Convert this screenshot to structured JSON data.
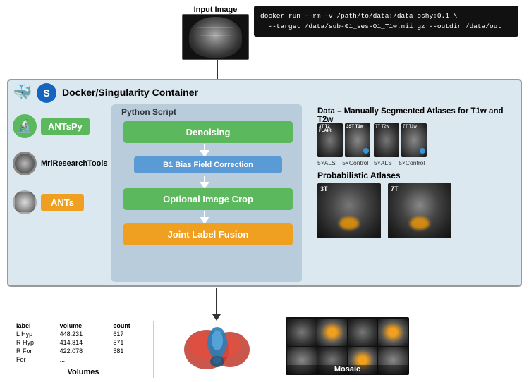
{
  "header": {
    "input_image_label": "Input Image",
    "command": "docker run --rm -v /path/to/data:/data oshy:0.1 \\\n  --target /data/sub-01_ses-01_T1w.nii.gz --outdir /data/out"
  },
  "docker": {
    "label": "Docker/Singularity Container"
  },
  "python_script": {
    "label": "Python Script"
  },
  "tools": [
    {
      "name": "ANTsPy",
      "type": "antspy"
    },
    {
      "name": "MriResearchTools",
      "type": "mri"
    },
    {
      "name": "ANTs",
      "type": "ants"
    }
  ],
  "pipeline": {
    "steps": [
      {
        "label": "Denoising",
        "color": "green"
      },
      {
        "label": "B1 Bias Field Correction",
        "color": "blue"
      },
      {
        "label": "Optional Image Crop",
        "color": "green"
      },
      {
        "label": "Joint Label Fusion",
        "color": "orange"
      }
    ]
  },
  "data_section": {
    "title": "Data – Manually Segmented Atlases for T1w and T2w",
    "atlas_groups": [
      {
        "label": "5×ALS  5×Control",
        "type": "t2_t1w"
      },
      {
        "label": "5×ALS  5×Control",
        "type": "t1w_7t"
      }
    ],
    "prob_title": "Probabilistic Atlases",
    "prob_images": [
      {
        "label": "3T"
      },
      {
        "label": "7T"
      }
    ]
  },
  "outputs": {
    "volumes_label": "Volumes",
    "table": {
      "headers": [
        "label",
        "volume",
        "count"
      ],
      "rows": [
        [
          "L Hyp",
          "448.231",
          "617"
        ],
        [
          "R Hyp",
          "414.814",
          "571"
        ],
        [
          "R For",
          "422.078",
          "581"
        ],
        [
          "For",
          "...",
          "..."
        ]
      ]
    },
    "mosaic_label": "Mosaic"
  }
}
